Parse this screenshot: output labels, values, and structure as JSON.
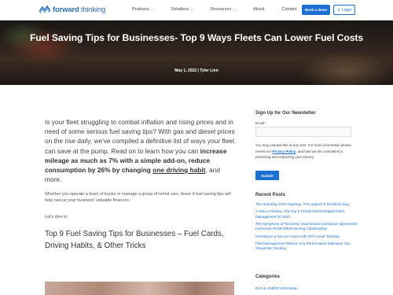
{
  "nav": {
    "logo_bold": "forward",
    "logo_light": " thinking",
    "menu": [
      {
        "label": "Products",
        "has_dropdown": true
      },
      {
        "label": "Solutions",
        "has_dropdown": true
      },
      {
        "label": "Resources",
        "has_dropdown": true
      },
      {
        "label": "About",
        "has_dropdown": false
      },
      {
        "label": "Contact",
        "has_dropdown": false
      }
    ],
    "book_demo": "Book a demo",
    "login": "Login",
    "accent_color": "#1a6fd1"
  },
  "hero": {
    "title": "Fuel Saving Tips for Businesses- Top 9 Ways Fleets Can Lower Fuel Costs",
    "meta": "May 1, 2022 | Tyler Linn"
  },
  "article": {
    "intro_1": "Is your fleet struggling to combat inflation and rising prices and in need of some serious fuel saving tips? With gas and diesel prices on the rise daily, we've compiled a definitive list of ways your fleet can save at the pump. Read on to learn how you can ",
    "intro_bold_1": "increase mileage as much as 7% with a simple add-on, reduce consumption by 26% by changing ",
    "intro_link": "one driving habit",
    "intro_2": ", and more.",
    "para_1": "Whether you operate a team of trucks or manage a group of rental cars, these 9 fuel saving tips will help rescue your business' valuable finances.",
    "para_2": "Let's dive in.",
    "heading": "Top 9 Fuel Saving Tips for Businesses – Fuel Cards, Driving Habits, & Other Tricks"
  },
  "sidebar": {
    "newsletter_title": "Sign Up for Our Newsletter",
    "email_label": "Email",
    "required_mark": "*",
    "note_1": "You may unsubscribe at any time. For more information please review our ",
    "note_link": "Privacy Policy",
    "note_2": ", and how we are committed to protecting and respecting your privacy.",
    "submit": "Submit",
    "recent_title": "Recent Posts",
    "recent_posts": [
      "The Haunting of the Highway: The Legend of the Black Dog",
      "A Year in Review: The Top 5 Trends that Reshaped Fleet Management for 2023",
      "The Symphony of Recovery: How Mutual Assistance Agreements Harmonize Relief Efforts During Catastrophes",
      "Investing in a Secure Future with GPS Asset Tracking",
      "Fleet Management Metrics: Key Performance Indicators You Should Be Tracking"
    ],
    "categories_title": "Categories",
    "categories": [
      "ELD & AOBRD Information"
    ]
  }
}
